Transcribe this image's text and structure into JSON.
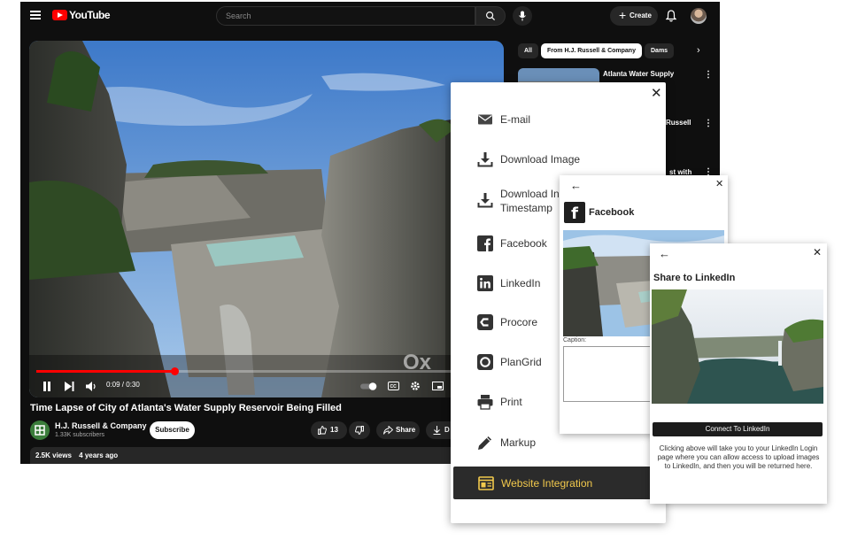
{
  "youtube": {
    "logo_text": "YouTube",
    "search_placeholder": "Search",
    "create_label": "Create",
    "video": {
      "title": "Time Lapse of City of Atlanta's Water Supply Reservoir Being Filled",
      "time_readout": "0:09 / 0:30",
      "progress_fraction": 0.3,
      "watermark": "Ox"
    },
    "channel": {
      "name": "H.J. Russell & Company",
      "subscribers": "1.33K subscribers",
      "subscribe_label": "Subscribe"
    },
    "actions": {
      "likes": "13",
      "share_label": "Share",
      "download_label": "D"
    },
    "stats": {
      "views": "2.5K views",
      "age": "4 years ago"
    },
    "chips": [
      "All",
      "From H.J. Russell & Company",
      "Dams"
    ],
    "recommendations": [
      {
        "title": "Atlanta Water Supply Program Overview"
      },
      {
        "title": "Russell"
      },
      {
        "title": "st with"
      }
    ]
  },
  "share_menu": {
    "items": [
      {
        "label": "E-mail",
        "icon": "email-icon"
      },
      {
        "label": "Download Image",
        "icon": "download-icon"
      },
      {
        "label": "Download Image with\nTimestamp",
        "icon": "download-timestamp-icon"
      },
      {
        "label": "Facebook",
        "icon": "facebook-icon"
      },
      {
        "label": "LinkedIn",
        "icon": "linkedin-icon"
      },
      {
        "label": "Procore",
        "icon": "procore-icon"
      },
      {
        "label": "PlanGrid",
        "icon": "plangrid-icon"
      },
      {
        "label": "Print",
        "icon": "print-icon"
      },
      {
        "label": "Markup",
        "icon": "pen-icon"
      },
      {
        "label": "Website Integration",
        "icon": "website-integration-icon"
      }
    ],
    "download_timestamp_visible": [
      "Download In",
      "Timestamp"
    ],
    "active_item": "Website Integration",
    "accent_color": "#f2c94c"
  },
  "facebook_panel": {
    "title": "Facebook",
    "caption_label": "Caption:"
  },
  "linkedin_panel": {
    "title": "Share to LinkedIn",
    "connect_label": "Connect To LinkedIn",
    "help_text": "Clicking above will take you to your LinkedIn Login page where you can allow access to upload images to LinkedIn, and then you will be returned here."
  }
}
